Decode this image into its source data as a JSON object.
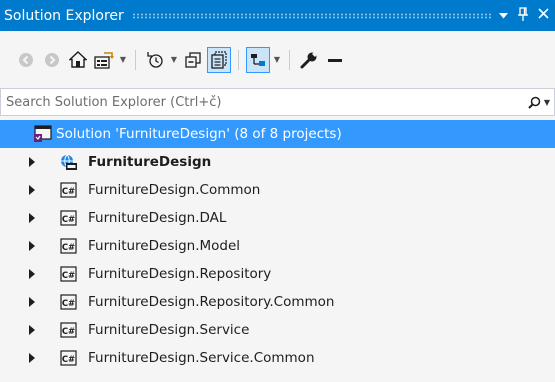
{
  "panel": {
    "title": "Solution Explorer",
    "title_icons": [
      "dropdown-arrow-icon",
      "pin-icon",
      "close-icon"
    ],
    "title_glyphs": {
      "dropdown": "▼",
      "pin": "𝟒",
      "close": "✕"
    }
  },
  "toolbar": {
    "buttons": [
      "back-icon",
      "forward-icon",
      "home-icon",
      "switch-views-icon",
      "pending-changes-filter-icon",
      "collapse-all-icon",
      "show-all-files-icon",
      "preview-selected-items-icon",
      "properties-icon",
      "minus-icon"
    ]
  },
  "search": {
    "placeholder": "Search Solution Explorer (Ctrl+č)"
  },
  "tree": {
    "solution_label": "Solution 'FurnitureDesign' (8 of 8 projects)",
    "projects": [
      {
        "label": "FurnitureDesign",
        "icon": "web-project-icon",
        "bold": true
      },
      {
        "label": "FurnitureDesign.Common",
        "icon": "csharp-project-icon"
      },
      {
        "label": "FurnitureDesign.DAL",
        "icon": "csharp-project-icon"
      },
      {
        "label": "FurnitureDesign.Model",
        "icon": "csharp-project-icon"
      },
      {
        "label": "FurnitureDesign.Repository",
        "icon": "csharp-project-icon"
      },
      {
        "label": "FurnitureDesign.Repository.Common",
        "icon": "csharp-project-icon"
      },
      {
        "label": "FurnitureDesign.Service",
        "icon": "csharp-project-icon"
      },
      {
        "label": "FurnitureDesign.Service.Common",
        "icon": "csharp-project-icon"
      }
    ]
  },
  "colors": {
    "accent": "#007acc",
    "selection": "#3399ff",
    "background": "#f5f5f5"
  }
}
